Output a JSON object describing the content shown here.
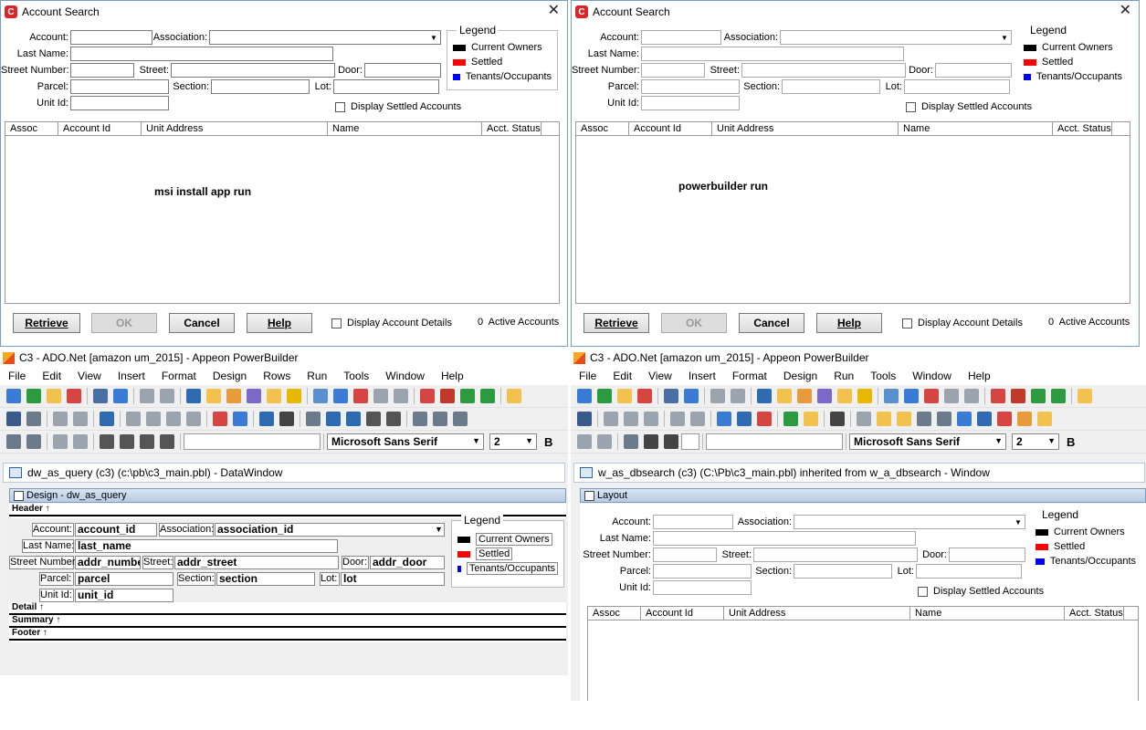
{
  "window_left": {
    "title": "Account Search",
    "fields": {
      "account": "Account:",
      "association": "Association:",
      "last_name": "Last Name:",
      "street_number": "Street Number:",
      "street": "Street:",
      "door": "Door:",
      "parcel": "Parcel:",
      "section": "Section:",
      "lot": "Lot:",
      "unit_id": "Unit Id:"
    },
    "legend": {
      "title": "Legend",
      "items": [
        {
          "label": "Current Owners",
          "color": "#000000"
        },
        {
          "label": "Settled",
          "color": "#ff0000"
        },
        {
          "label": "Tenants/Occupants",
          "color": "#0000ff"
        }
      ]
    },
    "display_settled": "Display Settled Accounts",
    "columns": [
      "Assoc",
      "Account Id",
      "Unit Address",
      "Name",
      "Acct. Status"
    ],
    "note": "msi install app run",
    "buttons": {
      "retrieve": "Retrieve",
      "ok": "OK",
      "cancel": "Cancel",
      "help": "Help"
    },
    "display_details": "Display Account Details",
    "active_count": "0",
    "active_label": "Active Accounts"
  },
  "window_right": {
    "title": "Account Search",
    "fields": {
      "account": "Account:",
      "association": "Association:",
      "last_name": "Last Name:",
      "street_number": "Street Number:",
      "street": "Street:",
      "door": "Door:",
      "parcel": "Parcel:",
      "section": "Section:",
      "lot": "Lot:",
      "unit_id": "Unit Id:"
    },
    "legend": {
      "title": "Legend",
      "items": [
        {
          "label": "Current Owners",
          "color": "#000000"
        },
        {
          "label": "Settled",
          "color": "#ff0000"
        },
        {
          "label": "Tenants/Occupants",
          "color": "#0000ff"
        }
      ]
    },
    "display_settled": "Display Settled Accounts",
    "columns": [
      "Assoc",
      "Account Id",
      "Unit Address",
      "Name",
      "Acct. Status"
    ],
    "note": "powerbuilder run",
    "buttons": {
      "retrieve": "Retrieve",
      "ok": "OK",
      "cancel": "Cancel",
      "help": "Help"
    },
    "display_details": "Display Account Details",
    "active_count": "0",
    "active_label": "Active Accounts"
  },
  "ide_left": {
    "title": "C3 - ADO.Net [amazon um_2015]  - Appeon PowerBuilder",
    "menu": [
      "File",
      "Edit",
      "View",
      "Insert",
      "Format",
      "Design",
      "Rows",
      "Run",
      "Tools",
      "Window",
      "Help"
    ],
    "font_name": "Microsoft Sans Serif",
    "font_size": "2",
    "bold_glyph": "B",
    "doc_title": "dw_as_query  (c3) (c:\\pb\\c3_main.pbl) - DataWindow",
    "pane_title": "Design - dw_as_query",
    "bands": {
      "header": "Header ↑",
      "detail": "Detail ↑",
      "summary": "Summary ↑",
      "footer": "Footer ↑"
    },
    "labels": {
      "account": "Account:",
      "association": "Association:",
      "last_name": "Last Name:",
      "street_number": "Street Number:",
      "street": "Street:",
      "door": "Door:",
      "parcel": "Parcel:",
      "section": "Section:",
      "lot": "Lot:",
      "unit_id": "Unit Id:"
    },
    "columns": {
      "account": "account_id",
      "association": "association_id",
      "last_name": "last_name",
      "street_number": "addr_number",
      "street": "addr_street",
      "door": "addr_door",
      "parcel": "parcel",
      "section": "section",
      "lot": "lot",
      "unit_id": "unit_id"
    },
    "legend": {
      "title": "Legend",
      "items": [
        {
          "label": "Current Owners",
          "color": "#000000"
        },
        {
          "label": "Settled",
          "color": "#ff0000"
        },
        {
          "label": "Tenants/Occupants",
          "color": "#0000ff"
        }
      ]
    }
  },
  "ide_right": {
    "title": "C3 - ADO.Net [amazon um_2015]  - Appeon PowerBuilder",
    "menu": [
      "File",
      "Edit",
      "View",
      "Insert",
      "Format",
      "Design",
      "Run",
      "Tools",
      "Window",
      "Help"
    ],
    "font_name": "Microsoft Sans Serif",
    "font_size": "2",
    "bold_glyph": "B",
    "doc_title": "w_as_dbsearch (c3) (C:\\Pb\\c3_main.pbl) inherited from w_a_dbsearch - Window",
    "pane_title": "Layout",
    "fields": {
      "account": "Account:",
      "association": "Association:",
      "last_name": "Last Name:",
      "street_number": "Street Number:",
      "street": "Street:",
      "door": "Door:",
      "parcel": "Parcel:",
      "section": "Section:",
      "lot": "Lot:",
      "unit_id": "Unit Id:"
    },
    "legend": {
      "title": "Legend",
      "items": [
        {
          "label": "Current Owners",
          "color": "#000000"
        },
        {
          "label": "Settled",
          "color": "#ff0000"
        },
        {
          "label": "Tenants/Occupants",
          "color": "#0000ff"
        }
      ]
    },
    "display_settled": "Display Settled Accounts",
    "columns": [
      "Assoc",
      "Account Id",
      "Unit Address",
      "Name",
      "Acct. Status"
    ]
  }
}
